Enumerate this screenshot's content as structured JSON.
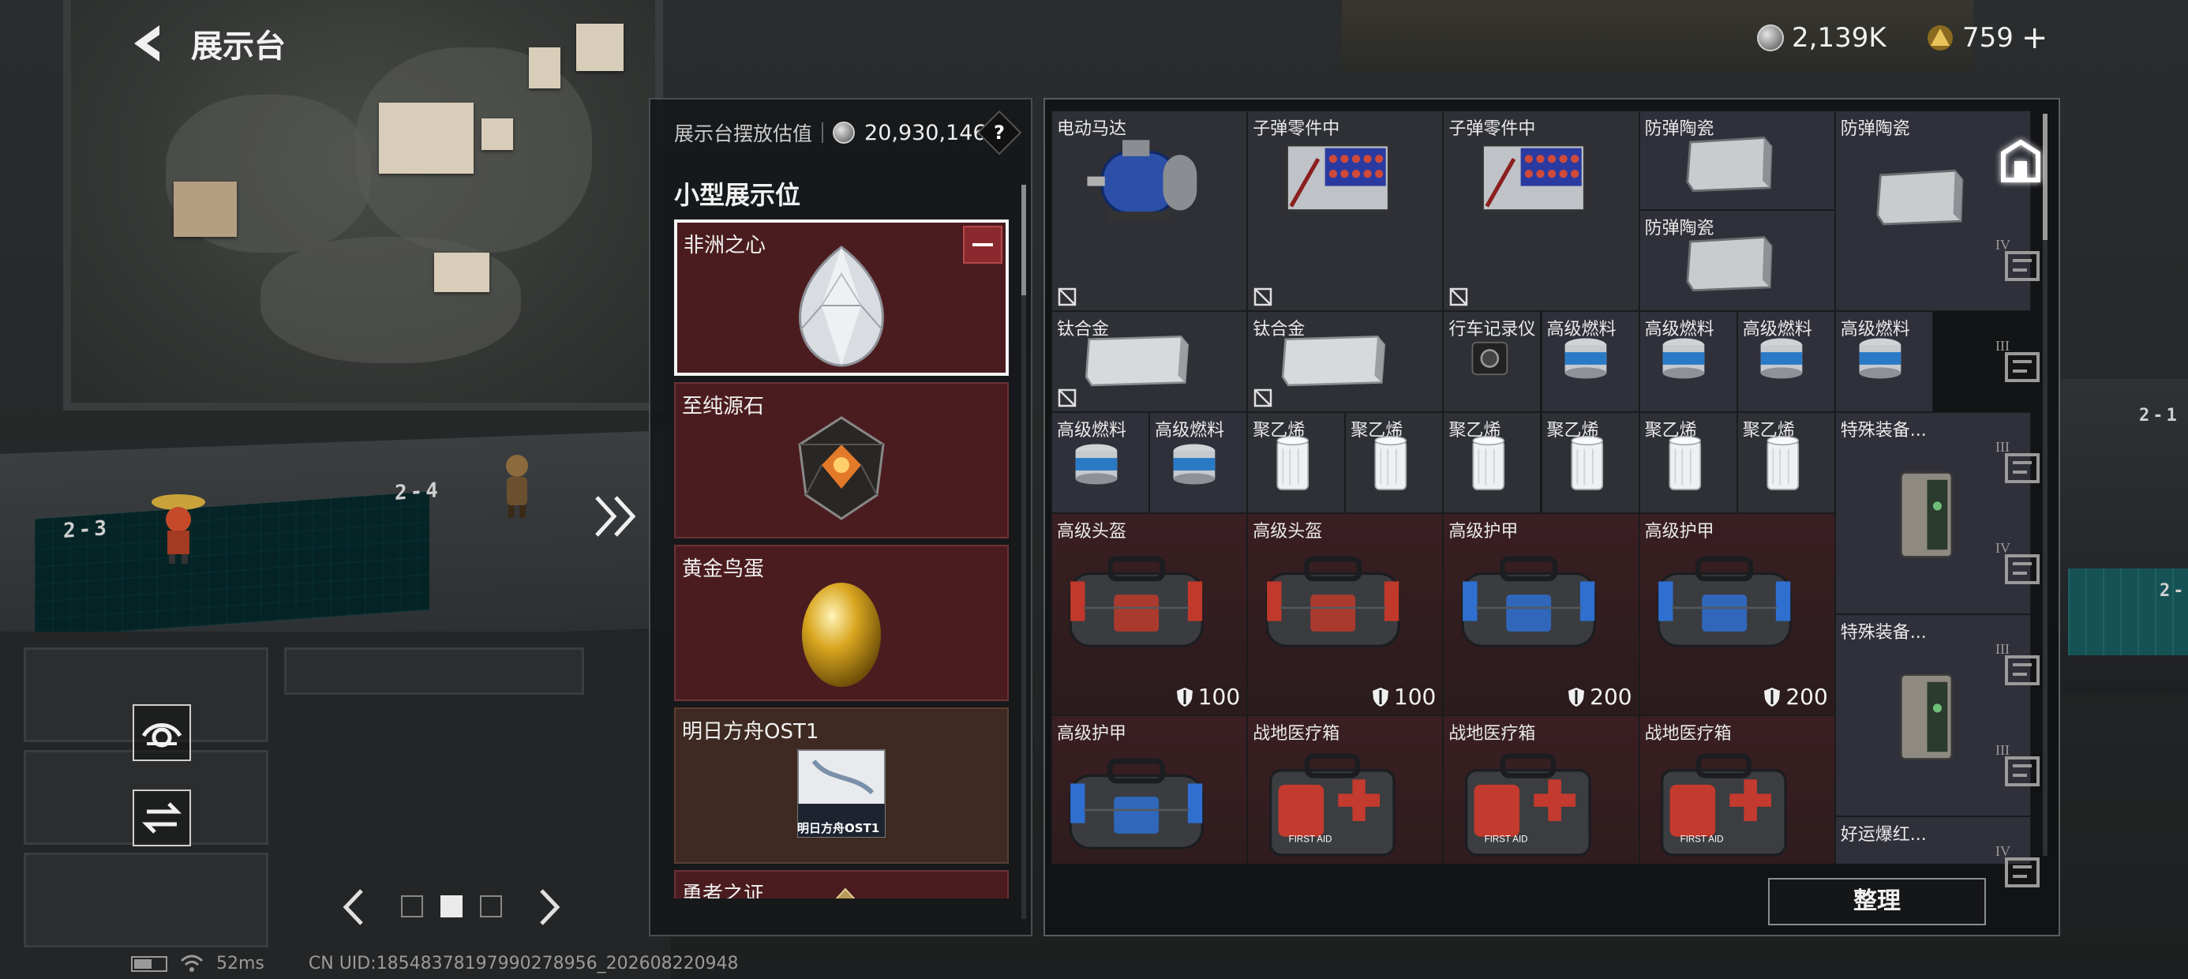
{
  "header": {
    "title": "展示台",
    "currency_silver": "2,139K",
    "currency_gold": "759",
    "plus_label": "+"
  },
  "display_panel": {
    "valuation_label": "展示台摆放估值",
    "valuation_value": "20,930,146",
    "help_label": "?",
    "section_title": "小型展示位",
    "slots": [
      {
        "name": "非洲之心",
        "selected": true,
        "art": "diamond-heart-icon"
      },
      {
        "name": "至纯源石",
        "selected": false,
        "art": "originium-icon"
      },
      {
        "name": "黄金鸟蛋",
        "selected": false,
        "art": "golden-egg-icon"
      },
      {
        "name": "明日方舟OST1",
        "selected": false,
        "art": "album-cd-icon",
        "album_text": "明日方舟OST1"
      },
      {
        "name": "勇者之证",
        "selected": false,
        "art": "badge-icon"
      }
    ]
  },
  "inventory": {
    "items": [
      {
        "label": "电动马达",
        "art": "motor-icon",
        "no_sell": true
      },
      {
        "label": "子弹零件中",
        "art": "ammo-parts-icon",
        "no_sell": true
      },
      {
        "label": "子弹零件中",
        "art": "ammo-parts-icon",
        "no_sell": true
      },
      {
        "label": "防弹陶瓷",
        "art": "ceramic-plate-icon"
      },
      {
        "label": "防弹陶瓷",
        "art": "ceramic-plate-icon"
      },
      {
        "label": "防弹陶瓷",
        "art": "ceramic-plate-icon"
      },
      {
        "label": "钛合金",
        "art": "titanium-plate-icon",
        "no_sell": true
      },
      {
        "label": "钛合金",
        "art": "titanium-plate-icon",
        "no_sell": true
      },
      {
        "label": "行车记录仪",
        "art": "dashcam-icon"
      },
      {
        "label": "高级燃料",
        "art": "fuel-can-icon"
      },
      {
        "label": "高级燃料",
        "art": "fuel-can-icon"
      },
      {
        "label": "高级燃料",
        "art": "fuel-can-icon"
      },
      {
        "label": "高级燃料",
        "art": "fuel-can-icon"
      },
      {
        "label": "高级燃料",
        "art": "fuel-can-icon"
      },
      {
        "label": "高级燃料",
        "art": "fuel-can-icon"
      },
      {
        "label": "聚乙烯",
        "art": "polyethylene-roll-icon"
      },
      {
        "label": "聚乙烯",
        "art": "polyethylene-roll-icon"
      },
      {
        "label": "聚乙烯",
        "art": "polyethylene-roll-icon"
      },
      {
        "label": "聚乙烯",
        "art": "polyethylene-roll-icon"
      },
      {
        "label": "聚乙烯",
        "art": "polyethylene-roll-icon"
      },
      {
        "label": "聚乙烯",
        "art": "polyethylene-roll-icon"
      },
      {
        "label": "特殊装备...",
        "art": "equipment-case-icon"
      },
      {
        "label": "高级头盔",
        "art": "helmet-bag-icon",
        "durability": "100"
      },
      {
        "label": "高级头盔",
        "art": "helmet-bag-icon",
        "durability": "100"
      },
      {
        "label": "高级护甲",
        "art": "armor-bag-icon",
        "durability": "200"
      },
      {
        "label": "高级护甲",
        "art": "armor-bag-icon",
        "durability": "200"
      },
      {
        "label": "特殊装备...",
        "art": "equipment-case-icon"
      },
      {
        "label": "高级护甲",
        "art": "armor-bag-icon"
      },
      {
        "label": "战地医疗箱",
        "art": "first-aid-kit-icon",
        "kit_text": "FIRST AID"
      },
      {
        "label": "战地医疗箱",
        "art": "first-aid-kit-icon",
        "kit_text": "FIRST AID"
      },
      {
        "label": "战地医疗箱",
        "art": "first-aid-kit-icon",
        "kit_text": "FIRST AID"
      },
      {
        "label": "好运爆红...",
        "art": "lucky-item-icon"
      }
    ],
    "sort_label": "整理"
  },
  "category_tabs": [
    {
      "icon": "all-items-icon",
      "active": true
    },
    {
      "icon": "tier-iv-container-icon",
      "level": "IV"
    },
    {
      "icon": "tier-iii-warning-icon",
      "level": "III"
    },
    {
      "icon": "tier-iii-warning-icon",
      "level": "III"
    },
    {
      "icon": "tier-iv-gear-icon",
      "level": "IV"
    },
    {
      "icon": "tier-iii-weapon-icon",
      "level": "III"
    },
    {
      "icon": "tier-iii-weapon-icon",
      "level": "III"
    },
    {
      "icon": "tier-iv-weapon-icon",
      "level": "IV"
    }
  ],
  "scene": {
    "mat_labels": [
      "2-3",
      "2-4"
    ],
    "right_labels": [
      "2-1",
      "2-"
    ]
  },
  "status_bar": {
    "ping": "52ms",
    "uid": "CN UID:18548378197990278956_202608220948"
  },
  "colors": {
    "slot_red": "#4b1c1f",
    "slot_brown": "#3e2a22",
    "panel_bg": "#161819",
    "accent_white": "#f4f4f4"
  }
}
